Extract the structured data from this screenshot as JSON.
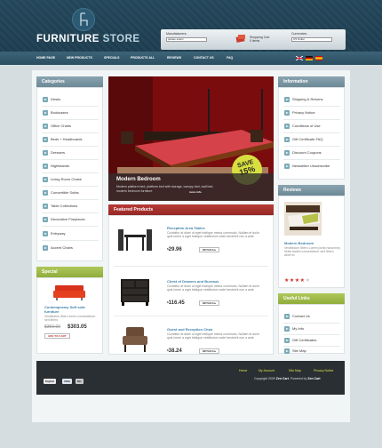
{
  "header": {
    "logo_part1": "FURNITURE",
    "logo_part2": "STORE"
  },
  "topbar": {
    "manufacturers_label": "Manufacturers:",
    "manufacturers_value": "please select",
    "currencies_label": "Currencies:",
    "currencies_value": "US Dollar",
    "cart_label": "Shopping Cart",
    "cart_count": "0 items"
  },
  "nav": {
    "items": [
      "HOME PAGE",
      "NEW PRODUCTS",
      "SPECIALS",
      "PRODUCTS ALL",
      "REVIEWS",
      "CONTACT US",
      "FAQ"
    ]
  },
  "categories": {
    "title": "Categories",
    "items": [
      "Desks",
      "Bookcases",
      "Office Chairs",
      "Beds + Headboards",
      "Dressers",
      "Nightstands",
      "Living Room Chairs",
      "Convertible Sofas",
      "Table Collections",
      "Decorative Fireplaces",
      "Entryway",
      "Accent Chairs"
    ]
  },
  "special": {
    "title": "Special",
    "product_name": "Contemporary Soft sofa furniture",
    "description": "Vestibulum libero lorem consectetuer sed libero",
    "old_price": "$350.00",
    "new_price": "$303.05",
    "add_to_cart": "ADD TO CART"
  },
  "hero": {
    "title": "Modern Bedroom",
    "description": "Modern platform bed, platform bed with storage, canopy bed, wall bed, modern bedroom furniture",
    "button": "more info",
    "badge_line1": "SAVE",
    "badge_line2": "15%"
  },
  "featured": {
    "title": "Featured Products",
    "products": [
      {
        "name": "Reception Area Tables",
        "description": "Curabitur at diam ut eget tristique metus commodo. Nullam et dolor quis lorem a eget tristique vestibulum ante hendrerit non a ante",
        "price": "29.96",
        "currency": "$",
        "button": "DETAILS"
      },
      {
        "name": "Chest of Drawers and Bureaus",
        "description": "Curabitur at diam ut eget tristique metus commodo. Nullam et dolor quis lorem a eget tristique vestibulum ante hendrerit non a ante",
        "price": "116.45",
        "currency": "$",
        "button": "DETAILS"
      },
      {
        "name": "Guest and Reception Chair",
        "description": "Curabitur at diam ut eget tristique metus commodo. Nullam et dolor quis lorem a eget tristique vestibulum ante hendrerit non a ante",
        "price": "38.24",
        "currency": "$",
        "button": "DETAILS"
      }
    ]
  },
  "information": {
    "title": "Information",
    "items": [
      "Shipping & Returns",
      "Privacy Notice",
      "Conditions of Use",
      "Gift Certificate FAQ",
      "Discount Coupons",
      "Newsletter Unsubscribe"
    ]
  },
  "reviews": {
    "title": "Reviews",
    "product": "Modern Bedroom",
    "text": "Vestibulum libero Lorem porta nonummy. Nulla facilisi consectetuer sed libero amet id",
    "rating": 4,
    "rating_max": 5
  },
  "useful_links": {
    "title": "Useful Links",
    "items": [
      "Contact Us",
      "My Info",
      "Gift Certificates",
      "Site Map"
    ]
  },
  "footer": {
    "links": [
      "Home",
      "My Account",
      "Site Map",
      "Privacy Notice"
    ],
    "copyright_prefix": "Copyright 2009",
    "copyright_brand1": "Zen Cart",
    "copyright_mid": ". Powered by",
    "copyright_brand2": "Zen Cart",
    "payments": [
      "PayPal",
      "VISA",
      "MC"
    ]
  },
  "colors": {
    "accent_blue": "#3c7fa9",
    "header_bg": "#23465a",
    "red": "#b73b38",
    "green": "#90ad3b"
  }
}
